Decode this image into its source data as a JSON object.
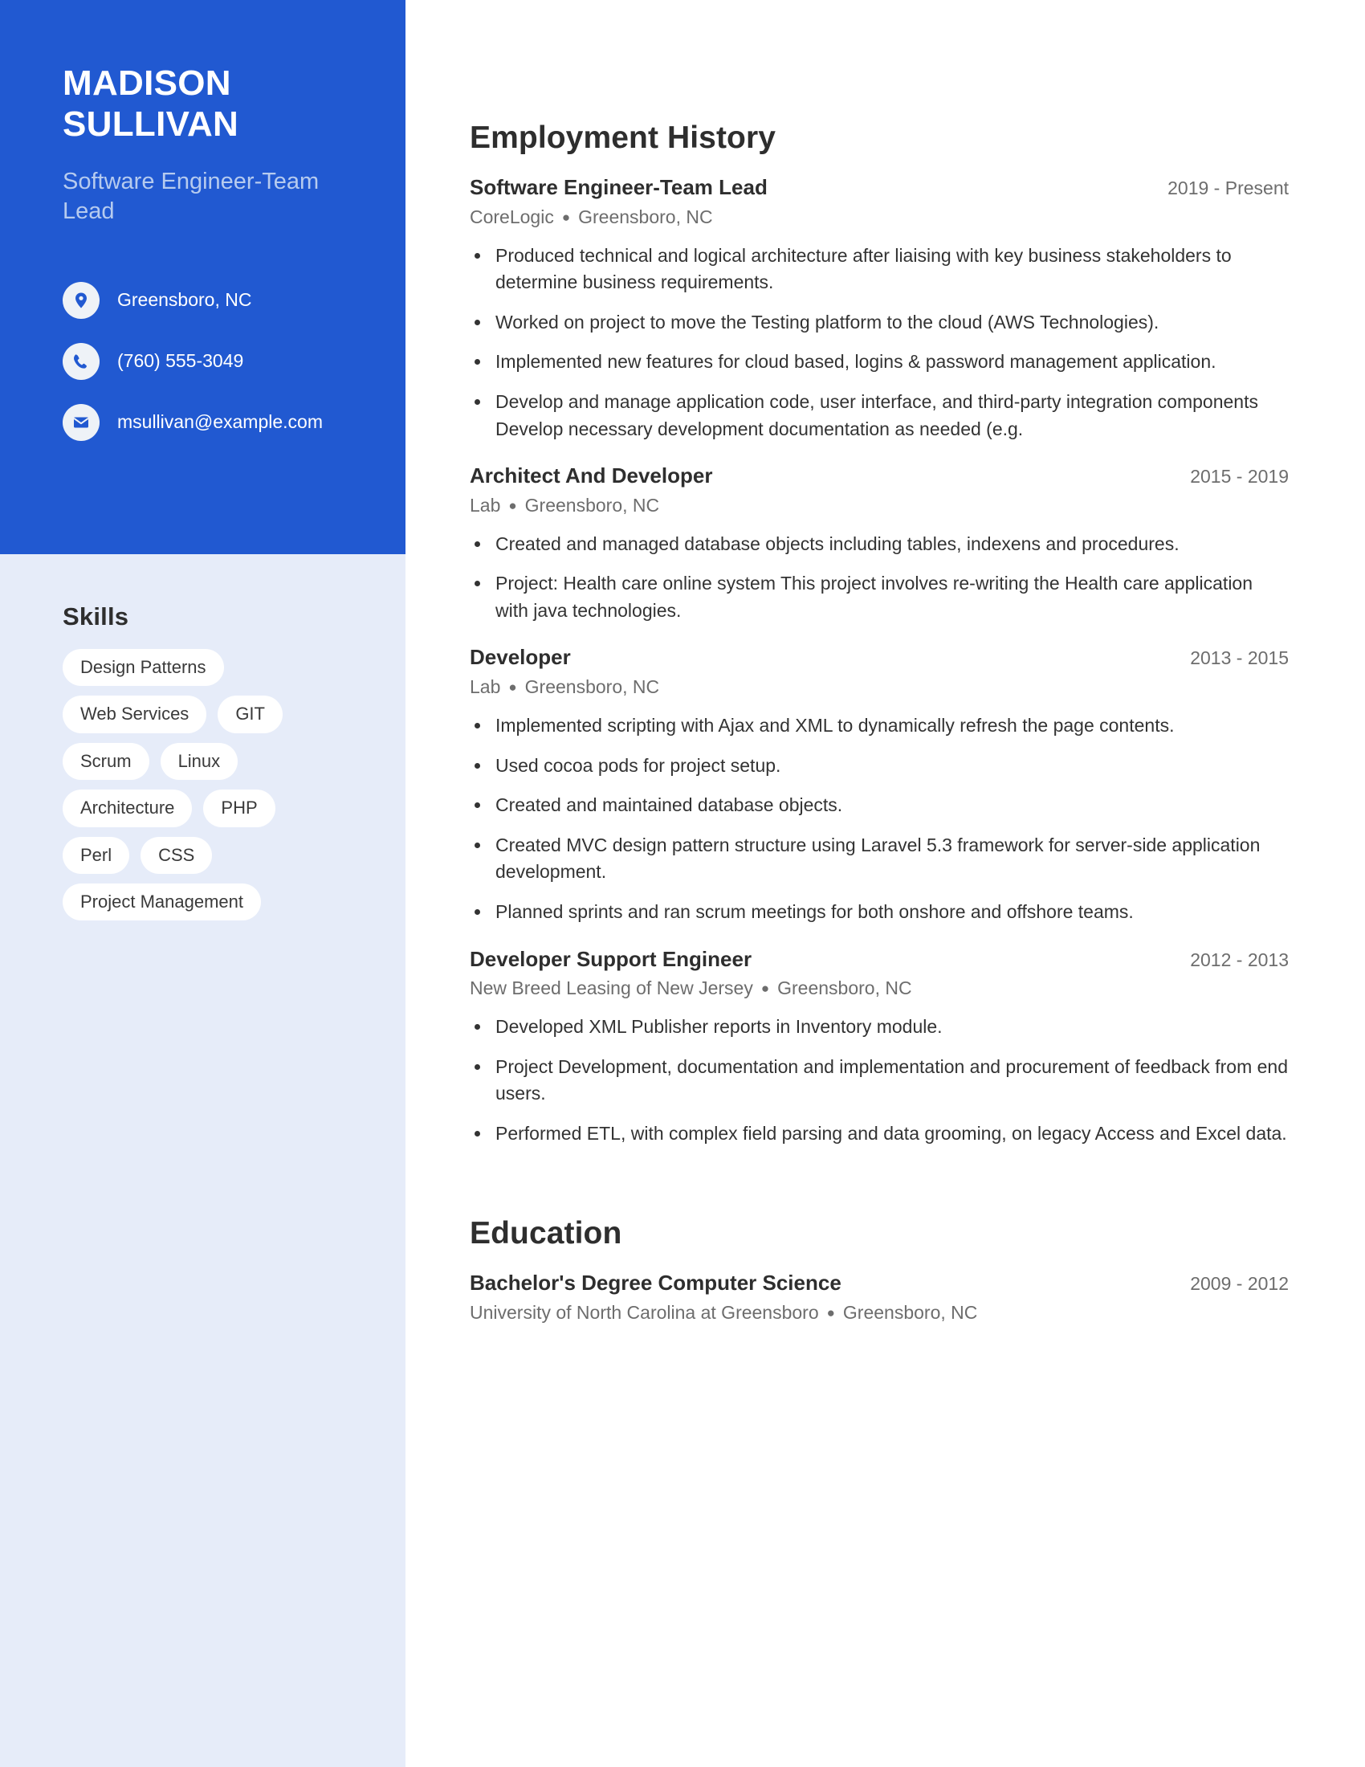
{
  "theme": {
    "accent": "#2159d1",
    "sidebar_light": "#e6ecf9",
    "subtitle": "#b6cbef",
    "muted_text": "#6d6d6d",
    "body_text": "#333333"
  },
  "sidebar": {
    "name": "Madison Sullivan",
    "job_title": "Software Engineer-Team Lead",
    "contacts": [
      {
        "icon": "location-pin-icon",
        "text": "Greensboro, NC"
      },
      {
        "icon": "phone-icon",
        "text": "(760) 555-3049"
      },
      {
        "icon": "email-icon",
        "text": "msullivan@example.com"
      }
    ],
    "skills_title": "Skills",
    "skills": [
      "Design Patterns",
      "Web Services",
      "GIT",
      "Scrum",
      "Linux",
      "Architecture",
      "PHP",
      "Perl",
      "CSS",
      "Project Management"
    ]
  },
  "main": {
    "employment_title": "Employment History",
    "employment": [
      {
        "role": "Software Engineer-Team Lead",
        "dates": "2019 - Present",
        "company": "CoreLogic",
        "location": "Greensboro, NC",
        "bullets": [
          "Produced technical and logical architecture after liaising with key business stakeholders to determine business requirements.",
          "Worked on project to move the Testing platform to the cloud (AWS Technologies).",
          "Implemented new features for cloud based, logins & password management application.",
          "Develop and manage application code, user interface, and third-party integration components Develop necessary development documentation as needed (e.g."
        ]
      },
      {
        "role": "Architect And Developer",
        "dates": "2015 - 2019",
        "company": "Lab",
        "location": "Greensboro, NC",
        "bullets": [
          "Created and managed database objects including tables, indexens and procedures.",
          "Project: Health care online system This project involves re-writing the Health care application with java technologies."
        ]
      },
      {
        "role": "Developer",
        "dates": "2013 - 2015",
        "company": "Lab",
        "location": "Greensboro, NC",
        "bullets": [
          "Implemented scripting with Ajax and XML to dynamically refresh the page contents.",
          "Used cocoa pods for project setup.",
          "Created and maintained database objects.",
          "Created MVC design pattern structure using Laravel 5.3 framework for server-side application development.",
          "Planned sprints and ran scrum meetings for both onshore and offshore teams."
        ]
      },
      {
        "role": "Developer Support Engineer",
        "dates": "2012 - 2013",
        "company": "New Breed Leasing of New Jersey",
        "location": "Greensboro, NC",
        "bullets": [
          "Developed XML Publisher reports in Inventory module.",
          "Project Development, documentation and implementation and procurement of feedback from end users.",
          "Performed ETL, with complex field parsing and data grooming, on legacy Access and Excel data."
        ]
      }
    ],
    "education_title": "Education",
    "education": [
      {
        "degree": "Bachelor's Degree Computer Science",
        "dates": "2009 - 2012",
        "school": "University of North Carolina at Greensboro",
        "location": "Greensboro, NC"
      }
    ]
  }
}
